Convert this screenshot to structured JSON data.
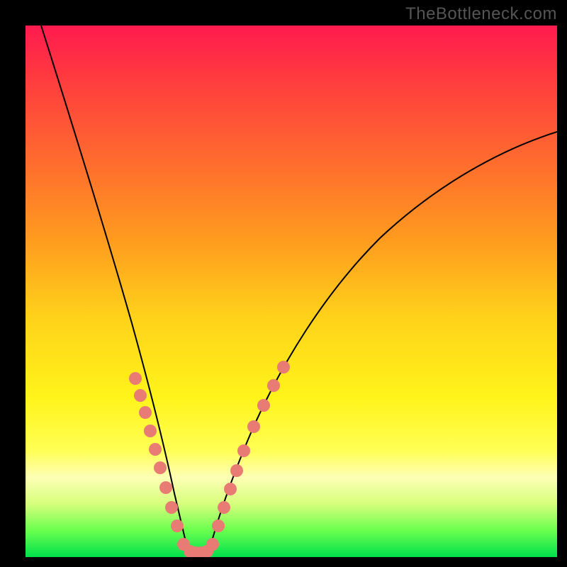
{
  "watermark": "TheBottleneck.com",
  "colors": {
    "frame_bg": "#000000",
    "dot_fill": "#e97b75",
    "curve_stroke": "#000000"
  },
  "chart_data": {
    "type": "line",
    "title": "",
    "xlabel": "",
    "ylabel": "",
    "xlim": [
      0,
      100
    ],
    "ylim": [
      0,
      100
    ],
    "grid": false,
    "series": [
      {
        "name": "left-curve",
        "x": [
          3,
          6,
          9,
          12,
          15,
          18,
          20,
          22,
          24,
          26,
          27,
          28,
          29,
          30
        ],
        "y": [
          100,
          87,
          75,
          63,
          52,
          42,
          34,
          27,
          20,
          12,
          8,
          5,
          2,
          0
        ]
      },
      {
        "name": "right-curve",
        "x": [
          34,
          36,
          38,
          40,
          43,
          47,
          52,
          58,
          65,
          73,
          82,
          91,
          100
        ],
        "y": [
          0,
          5,
          10,
          15,
          22,
          30,
          38,
          46,
          54,
          61,
          68,
          74,
          79
        ]
      }
    ],
    "scatter_points": {
      "left_curve_dots": [
        {
          "x": 20,
          "y": 34
        },
        {
          "x": 21,
          "y": 30
        },
        {
          "x": 22,
          "y": 27
        },
        {
          "x": 23,
          "y": 23
        },
        {
          "x": 24,
          "y": 20
        },
        {
          "x": 25,
          "y": 16
        },
        {
          "x": 26,
          "y": 12
        },
        {
          "x": 27,
          "y": 8
        },
        {
          "x": 28,
          "y": 5
        }
      ],
      "right_curve_dots": [
        {
          "x": 36,
          "y": 5
        },
        {
          "x": 37,
          "y": 8
        },
        {
          "x": 38,
          "y": 10
        },
        {
          "x": 39,
          "y": 13
        },
        {
          "x": 40,
          "y": 16
        },
        {
          "x": 42,
          "y": 21
        },
        {
          "x": 44,
          "y": 25
        },
        {
          "x": 46,
          "y": 29
        },
        {
          "x": 48,
          "y": 33
        }
      ],
      "bottom_dots": [
        {
          "x": 29,
          "y": 1
        },
        {
          "x": 30,
          "y": 0.5
        },
        {
          "x": 31,
          "y": 0.5
        },
        {
          "x": 32,
          "y": 0.5
        },
        {
          "x": 33,
          "y": 0.5
        },
        {
          "x": 34,
          "y": 1
        }
      ]
    }
  }
}
